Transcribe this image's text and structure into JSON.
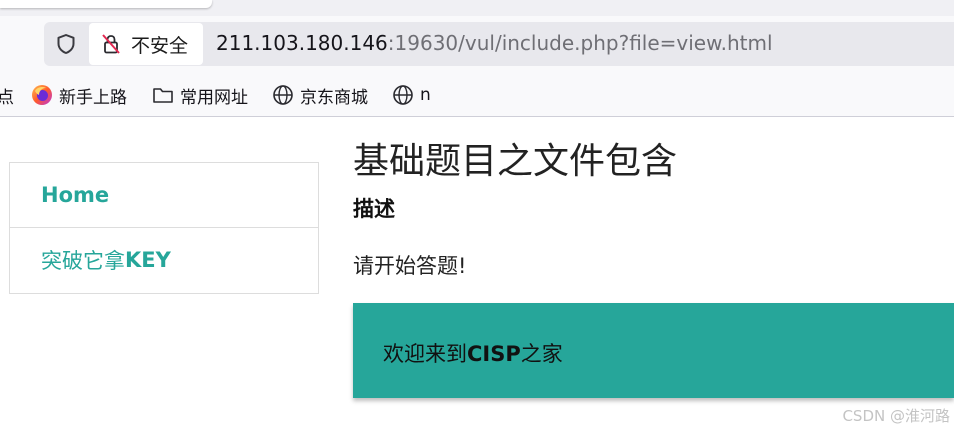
{
  "browser": {
    "security_label": "不安全",
    "url_host": "211.103.180.146",
    "url_rest": ":19630/vul/include.php?file=view.html",
    "bookmarks": [
      {
        "label": "点",
        "icon": "none"
      },
      {
        "label": "新手上路",
        "icon": "firefox-icon"
      },
      {
        "label": "常用网址",
        "icon": "folder-icon"
      },
      {
        "label": "京东商城",
        "icon": "globe-icon"
      },
      {
        "label": "n",
        "icon": "globe-icon"
      }
    ]
  },
  "sidebar": {
    "items": [
      {
        "label": "Home"
      },
      {
        "label_prefix": "突破它拿",
        "label_suffix": "KEY"
      }
    ]
  },
  "main": {
    "title": "基础题目之文件包含",
    "description_heading": "描述",
    "description_text": "请开始答题!",
    "banner_prefix": "欢迎来到",
    "banner_bold": "CISP",
    "banner_suffix": "之家"
  },
  "watermark": "CSDN @淮河路",
  "colors": {
    "accent": "#26a69a",
    "chrome_bg": "#f9f9fb",
    "urlbar_bg": "#e8e8ed"
  }
}
